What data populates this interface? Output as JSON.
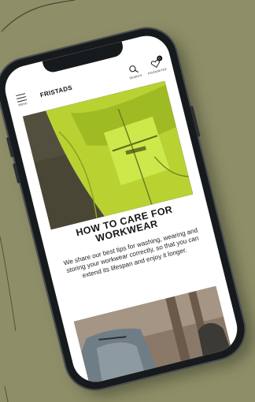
{
  "header": {
    "menu_label": "MENU",
    "logo": "FRISTADS",
    "search_label": "SEARCH",
    "favourites_label": "FAVOURITES",
    "favourites_count": "0"
  },
  "article": {
    "title_line1": "HOW TO CARE FOR",
    "title_line2": "WORKWEAR",
    "body": "We share our best tips for washing, wearing and storing your workwear correctly, so that you can extend its lifespan and enjoy it longer."
  },
  "colors": {
    "background": "#8e8f68",
    "phone_frame": "#171a1c",
    "hi_vis_yellow": "#c9e23a"
  },
  "icons": [
    "menu-icon",
    "search-icon",
    "heart-icon"
  ]
}
